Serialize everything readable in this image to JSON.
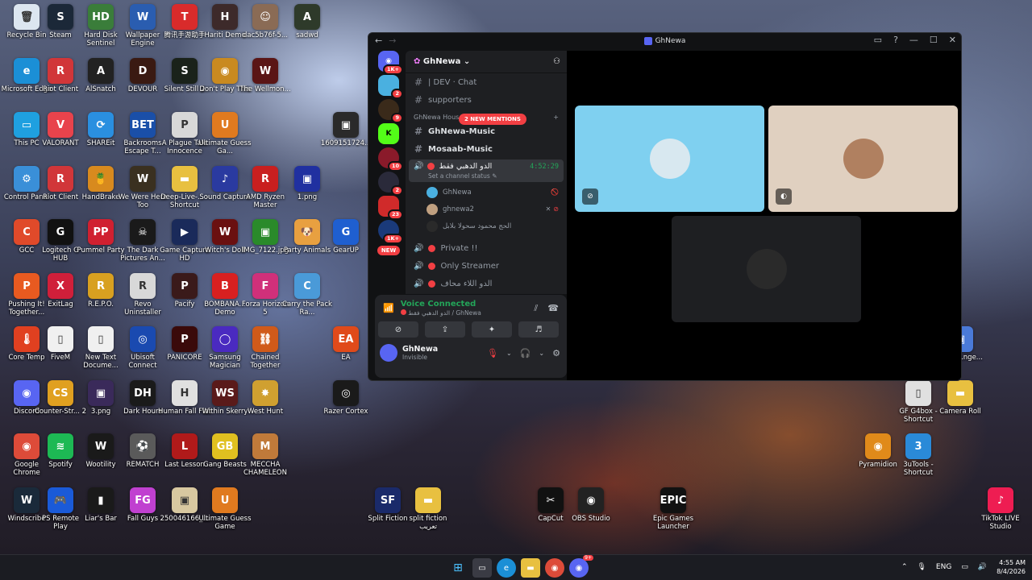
{
  "desktop": {
    "icons": [
      {
        "label": "Recycle Bin",
        "icon": "recycle-bin-icon",
        "color": "#dce6f0",
        "glyph": "🗑"
      },
      {
        "label": "Steam",
        "icon": "steam-icon",
        "color": "#1b2838",
        "glyph": "S"
      },
      {
        "label": "Hard Disk Sentinel",
        "icon": "hard-disk-sentinel-icon",
        "color": "#3a7d3a",
        "glyph": "HD"
      },
      {
        "label": "Wallpaper Engine",
        "icon": "wallpaper-engine-icon",
        "color": "#2a5db0",
        "glyph": "W"
      },
      {
        "label": "腾讯手游助手",
        "icon": "tencent-gaming-icon",
        "color": "#d92b2b",
        "glyph": "T"
      },
      {
        "label": "Hariti Demo",
        "icon": "hariti-demo-icon",
        "color": "#3d2a2a",
        "glyph": "H"
      },
      {
        "label": "dac5b76f-5...",
        "icon": "image-file-icon",
        "color": "#8a6b55",
        "glyph": "☺"
      },
      {
        "label": "sadwd",
        "icon": "assassins-creed-icon",
        "color": "#2e3a2a",
        "glyph": "A"
      },
      {
        "label": "Microsoft Edge",
        "icon": "edge-icon",
        "color": "#1b8fd6",
        "glyph": "e"
      },
      {
        "label": "Riot Client",
        "icon": "riot-client-icon",
        "color": "#d13639",
        "glyph": "R"
      },
      {
        "label": "AlSnatch",
        "icon": "alsnatch-icon",
        "color": "#222",
        "glyph": "A"
      },
      {
        "label": "DEVOUR",
        "icon": "devour-icon",
        "color": "#3a1a12",
        "glyph": "D"
      },
      {
        "label": "Silent Still 2",
        "icon": "silent-still-icon",
        "color": "#1a221a",
        "glyph": "S"
      },
      {
        "label": "Don't Play This",
        "icon": "dont-play-this-icon",
        "color": "#c98a20",
        "glyph": "◉"
      },
      {
        "label": "The Wellmon...",
        "icon": "wellmon-icon",
        "color": "#5a1515",
        "glyph": "W"
      },
      {
        "label": "This PC",
        "icon": "this-pc-icon",
        "color": "#1fa0e0",
        "glyph": "▭"
      },
      {
        "label": "VALORANT",
        "icon": "valorant-icon",
        "color": "#e8434c",
        "glyph": "V"
      },
      {
        "label": "SHAREit",
        "icon": "shareit-icon",
        "color": "#2a8fe0",
        "glyph": "⟳"
      },
      {
        "label": "Backrooms Escape T...",
        "icon": "backrooms-icon",
        "color": "#1a4fa8",
        "glyph": "BET"
      },
      {
        "label": "A Plague Tale Innocence",
        "icon": "plague-tale-icon",
        "color": "#d8d8d8",
        "glyph": "P"
      },
      {
        "label": "Ultimate Guess Ga...",
        "icon": "ultimate-guess-icon",
        "color": "#e07a1f",
        "glyph": "U"
      },
      {
        "label": "1609151724...",
        "icon": "image-file-icon",
        "color": "#2a2a2a",
        "glyph": "▣"
      },
      {
        "label": "Control Panel",
        "icon": "control-panel-icon",
        "color": "#3a8fd8",
        "glyph": "⚙"
      },
      {
        "label": "Riot Client",
        "icon": "riot-client-icon",
        "color": "#d13639",
        "glyph": "R"
      },
      {
        "label": "HandBrake",
        "icon": "handbrake-icon",
        "color": "#d88a1e",
        "glyph": "🍍"
      },
      {
        "label": "We Were Here Too",
        "icon": "we-were-here-icon",
        "color": "#3a3020",
        "glyph": "W"
      },
      {
        "label": "Deep-Live-... - Shortcut",
        "icon": "folder-icon",
        "color": "#e8c040",
        "glyph": "▬"
      },
      {
        "label": "Sound Capture",
        "icon": "sound-capture-icon",
        "color": "#2a3aa0",
        "glyph": "♪"
      },
      {
        "label": "AMD Ryzen Master",
        "icon": "amd-ryzen-icon",
        "color": "#c91f1f",
        "glyph": "R"
      },
      {
        "label": "1.png",
        "icon": "image-file-icon",
        "color": "#2030a0",
        "glyph": "▣"
      },
      {
        "label": "GCC",
        "icon": "gcc-icon",
        "color": "#e04a2a",
        "glyph": "C"
      },
      {
        "label": "Logitech G HUB",
        "icon": "logitech-icon",
        "color": "#111",
        "glyph": "G"
      },
      {
        "label": "Pummel Party",
        "icon": "pummel-party-icon",
        "color": "#d02030",
        "glyph": "PP"
      },
      {
        "label": "The Dark Pictures An...",
        "icon": "dark-pictures-icon",
        "color": "#1a1a1a",
        "glyph": "☠"
      },
      {
        "label": "Game Capture HD",
        "icon": "game-capture-icon",
        "color": "#1a2a5a",
        "glyph": "▶"
      },
      {
        "label": "Witch's Doll",
        "icon": "witchs-doll-icon",
        "color": "#6a1010",
        "glyph": "W"
      },
      {
        "label": "IMG_7122.jpg",
        "icon": "image-file-icon",
        "color": "#2a8a2a",
        "glyph": "▣"
      },
      {
        "label": "Party Animals",
        "icon": "party-animals-icon",
        "color": "#e8a040",
        "glyph": "🐶"
      },
      {
        "label": "GearUP",
        "icon": "gearup-icon",
        "color": "#1f5fd0",
        "glyph": "G"
      },
      {
        "label": "Pushing It! Together...",
        "icon": "pushing-it-icon",
        "color": "#e85a20",
        "glyph": "P"
      },
      {
        "label": "ExitLag",
        "icon": "exitlag-icon",
        "color": "#d01f3a",
        "glyph": "X"
      },
      {
        "label": "R.E.P.O.",
        "icon": "repo-icon",
        "color": "#d8a020",
        "glyph": "R"
      },
      {
        "label": "Revo Uninstaller",
        "icon": "revo-uninstaller-icon",
        "color": "#d8d8d8",
        "glyph": "R"
      },
      {
        "label": "Pacify",
        "icon": "pacify-icon",
        "color": "#3a1a1a",
        "glyph": "P"
      },
      {
        "label": "BOMBANA... Demo",
        "icon": "bombana-icon",
        "color": "#d82020",
        "glyph": "B"
      },
      {
        "label": "Forza Horizon 5",
        "icon": "forza-icon",
        "color": "#d0307a",
        "glyph": "F"
      },
      {
        "label": "Carry the Pack Ra...",
        "icon": "carry-pack-icon",
        "color": "#4a9ad8",
        "glyph": "C"
      },
      {
        "label": "Core Temp",
        "icon": "core-temp-icon",
        "color": "#e04020",
        "glyph": "🌡"
      },
      {
        "label": "FiveM",
        "icon": "fivem-icon",
        "color": "#f0f0f0",
        "glyph": "▯"
      },
      {
        "label": "New Text Docume...",
        "icon": "text-file-icon",
        "color": "#f0f0f0",
        "glyph": "▯"
      },
      {
        "label": "Ubisoft Connect",
        "icon": "ubisoft-icon",
        "color": "#1a4ab0",
        "glyph": "◎"
      },
      {
        "label": "PANICORE",
        "icon": "panicore-icon",
        "color": "#3a0a0a",
        "glyph": "P"
      },
      {
        "label": "Samsung Magician",
        "icon": "samsung-magician-icon",
        "color": "#4a2ac0",
        "glyph": "◯"
      },
      {
        "label": "Chained Together",
        "icon": "chained-together-icon",
        "color": "#d05a1a",
        "glyph": "⛓"
      },
      {
        "label": "EA",
        "icon": "ea-icon",
        "color": "#e04a1a",
        "glyph": "EA"
      },
      {
        "label": "Discord",
        "icon": "discord-icon",
        "color": "#5865f2",
        "glyph": "◉"
      },
      {
        "label": "Counter-Str... 2",
        "icon": "counter-strike-icon",
        "color": "#e0a020",
        "glyph": "CS"
      },
      {
        "label": "3.png",
        "icon": "image-file-icon",
        "color": "#3a2a5a",
        "glyph": "▣"
      },
      {
        "label": "Dark Hours",
        "icon": "dark-hours-icon",
        "color": "#1a1a1a",
        "glyph": "DH"
      },
      {
        "label": "Human Fall Flat",
        "icon": "human-fall-flat-icon",
        "color": "#e0e0e0",
        "glyph": "H"
      },
      {
        "label": "Within Skerry",
        "icon": "within-skerry-icon",
        "color": "#5a1a1a",
        "glyph": "WS"
      },
      {
        "label": "West Hunt",
        "icon": "west-hunt-icon",
        "color": "#d0a030",
        "glyph": "✸"
      },
      {
        "label": "Razer Cortex",
        "icon": "razer-cortex-icon",
        "color": "#1a1a1a",
        "glyph": "◎"
      },
      {
        "label": "Google Chrome",
        "icon": "chrome-icon",
        "color": "#dd4b39",
        "glyph": "◉"
      },
      {
        "label": "Spotify",
        "icon": "spotify-icon",
        "color": "#1db954",
        "glyph": "≋"
      },
      {
        "label": "Wootility",
        "icon": "wootility-icon",
        "color": "#1a1a1a",
        "glyph": "W"
      },
      {
        "label": "REMATCH",
        "icon": "rematch-icon",
        "color": "#5a5a5a",
        "glyph": "⚽"
      },
      {
        "label": "Last Lesson",
        "icon": "last-lesson-icon",
        "color": "#b01a1a",
        "glyph": "L"
      },
      {
        "label": "Gang Beasts",
        "icon": "gang-beasts-icon",
        "color": "#e0c020",
        "glyph": "GB"
      },
      {
        "label": "MECCHA CHAMELEON",
        "icon": "meccha-chameleon-icon",
        "color": "#c07a3a",
        "glyph": "M"
      },
      {
        "label": "Pyramidion",
        "icon": "pyramidion-icon",
        "color": "#e08a1a",
        "glyph": "◉"
      },
      {
        "label": "3uTools - Shortcut",
        "icon": "3utools-icon",
        "color": "#2a8ad8",
        "glyph": "3"
      },
      {
        "label": "Windscribe",
        "icon": "windscribe-icon",
        "color": "#1a2a3a",
        "glyph": "W"
      },
      {
        "label": "PS Remote Play",
        "icon": "ps-remote-play-icon",
        "color": "#1a5ad8",
        "glyph": "🎮"
      },
      {
        "label": "Liar's Bar",
        "icon": "liars-bar-icon",
        "color": "#1a1a1a",
        "glyph": "▮"
      },
      {
        "label": "Fall Guys",
        "icon": "fall-guys-icon",
        "color": "#c040d0",
        "glyph": "FG"
      },
      {
        "label": "250046166_...",
        "icon": "image-file-icon",
        "color": "#d8c8a0",
        "glyph": "▣"
      },
      {
        "label": "Ultimate Guess Game",
        "icon": "ultimate-guess-icon",
        "color": "#e07a1f",
        "glyph": "U"
      },
      {
        "label": "Split Fiction",
        "icon": "split-fiction-icon",
        "color": "#1a2a6a",
        "glyph": "SF"
      },
      {
        "label": "split fiction تعريب",
        "icon": "folder-icon",
        "color": "#e8c040",
        "glyph": "▬"
      },
      {
        "label": "CapCut",
        "icon": "capcut-icon",
        "color": "#111",
        "glyph": "✂"
      },
      {
        "label": "OBS Studio",
        "icon": "obs-icon",
        "color": "#222",
        "glyph": "◉"
      },
      {
        "label": "Epic Games Launcher",
        "icon": "epic-games-icon",
        "color": "#111",
        "glyph": "EPIC"
      },
      {
        "label": "TikTok LIVE Studio",
        "icon": "tiktok-live-icon",
        "color": "#ee1d52",
        "glyph": "♪"
      },
      {
        "label": "GF G4box - Shortcut",
        "icon": "shortcut-file-icon",
        "color": "#e0e0e0",
        "glyph": "▯"
      },
      {
        "label": "Camera Roll",
        "icon": "folder-icon",
        "color": "#e8c040",
        "glyph": "▬"
      },
      {
        "label": "...eel ...nge...",
        "icon": "wheel-icon",
        "color": "#4a7ad8",
        "glyph": "▣"
      }
    ]
  },
  "discord": {
    "window_title": "GhNewa",
    "server_name": "GhNewa",
    "guild_badges": [
      "1K+",
      "2",
      "9",
      "",
      "10",
      "2",
      "23",
      "1K+"
    ],
    "new_label": "NEW",
    "channels_top": [
      {
        "name": "| DEV · Chat"
      },
      {
        "name": "supporters"
      }
    ],
    "mention_pill": "2 NEW MENTIONS",
    "category": "GhNewa House",
    "channels": [
      {
        "name": "GhNewa-Music"
      },
      {
        "name": "Mosaab-Music"
      }
    ],
    "active_voice": {
      "name": "الدو الدهبي فقط",
      "timer": "4:52:29",
      "status": "Set a channel status"
    },
    "voice_users": [
      {
        "name": "GhNewa"
      },
      {
        "name": "ghnewa2"
      },
      {
        "name": "الحج محمود سحولا بلابل"
      }
    ],
    "voice_channels_below": [
      {
        "name": "Private !!"
      },
      {
        "name": "Only Streamer"
      },
      {
        "name": "الدو اللاء محاف"
      }
    ],
    "voice_panel": {
      "status": "Voice Connected",
      "subtitle": "الدو الدهبي فقط / GhNewa"
    },
    "user": {
      "name": "GhNewa",
      "status": "Invisible"
    },
    "tiles": [
      {
        "bg": "#7fd0f0"
      },
      {
        "bg": "#e0d0c0"
      },
      {
        "bg": "#1e1f22"
      }
    ]
  },
  "taskbar": {
    "language": "ENG",
    "time": "4:55 AM",
    "date": "8/4/2026",
    "discord_badge": "9+"
  },
  "colors": {
    "discord_accent": "#5865f2",
    "voice_green": "#23a559",
    "mention_red": "#f23f43"
  }
}
